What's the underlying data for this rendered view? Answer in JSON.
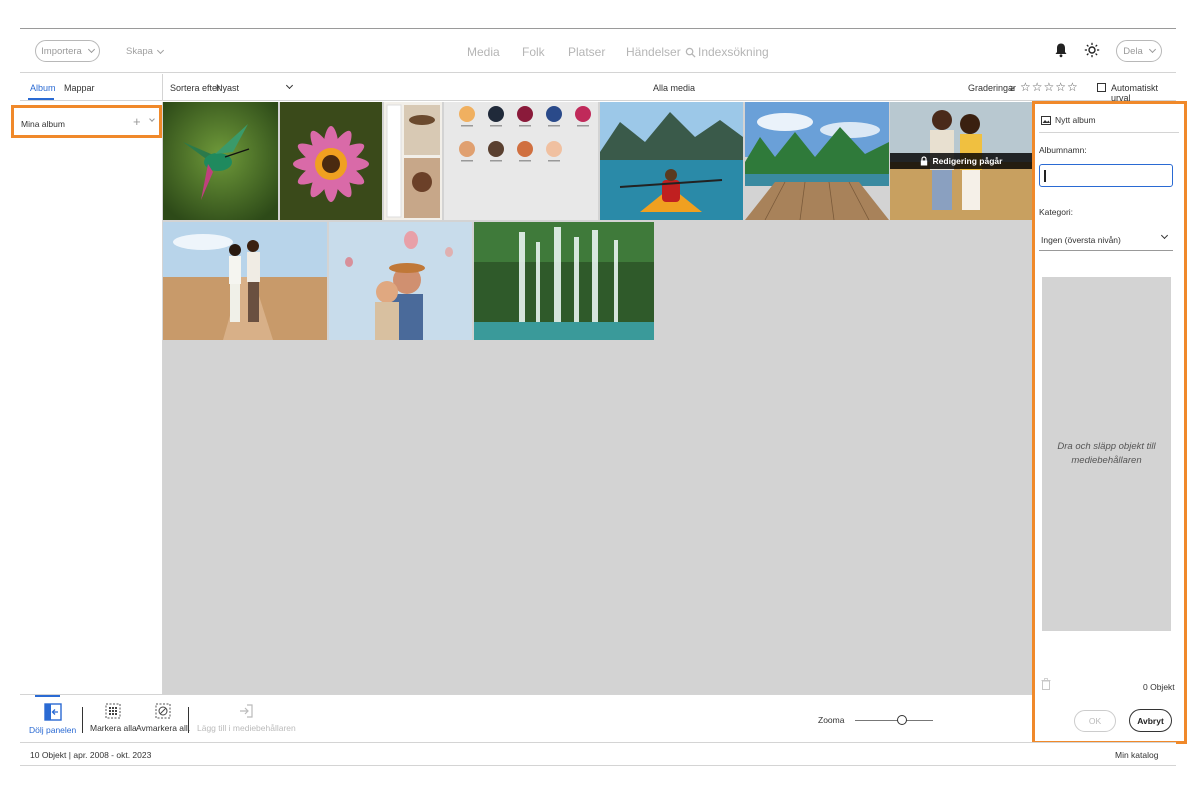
{
  "topbar": {
    "import_label": "Importera",
    "create_label": "Skapa",
    "nav": [
      "Media",
      "Folk",
      "Platser",
      "Händelser",
      "Indexsökning"
    ],
    "share_label": "Dela"
  },
  "subbar": {
    "tabs": [
      "Album",
      "Mappar"
    ],
    "sort_label": "Sortera efter:",
    "sort_value": "Nyast",
    "center_title": "Alla media",
    "ratings_label": "Graderingar",
    "ratings_op": "≥",
    "stars": "☆☆☆☆☆",
    "auto_select_label": "Automatiskt urval"
  },
  "sidebar": {
    "my_albums": "Mina album",
    "add_symbol": "+"
  },
  "grid": {
    "edit_in_progress": "Redigering pågår"
  },
  "panel": {
    "title": "Nytt album",
    "album_name_label": "Albumnamn:",
    "album_name_value": "",
    "category_label": "Kategori:",
    "category_value": "Ingen (översta nivån)",
    "dropzone_text": "Dra och släpp objekt till mediebehållaren",
    "object_count": "0 Objekt",
    "ok_label": "OK",
    "cancel_label": "Avbryt"
  },
  "toolbar": {
    "hide_panel": "Dölj panelen",
    "select_all": "Markera alla",
    "deselect_all": "Avmarkera all.",
    "add_to_tray": "Lägg till i mediebehållaren",
    "zoom_label": "Zooma",
    "zoom_level": 0.6
  },
  "status": {
    "count": "10 Objekt",
    "separator": "|",
    "date_range": "apr. 2008 - okt. 2023",
    "catalog": "Min katalog"
  },
  "colors": {
    "accent": "#2a6ad3",
    "highlight": "#f0892a",
    "grid_bg": "#d3d3d3"
  }
}
